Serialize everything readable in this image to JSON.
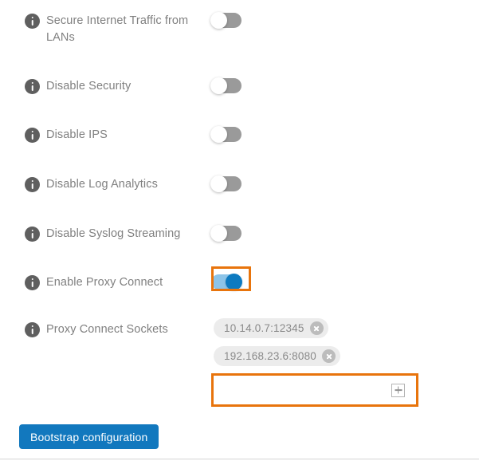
{
  "settings": {
    "rows": [
      {
        "label": "Secure Internet Traffic from LANs",
        "toggle_state": "off",
        "icon": "info-icon",
        "name": "secure-internet-traffic-from-lans"
      },
      {
        "label": "Disable Security",
        "toggle_state": "off",
        "icon": "info-icon",
        "name": "disable-security"
      },
      {
        "label": "Disable IPS",
        "toggle_state": "off",
        "icon": "info-icon",
        "name": "disable-ips"
      },
      {
        "label": "Disable Log Analytics",
        "toggle_state": "off",
        "icon": "info-icon",
        "name": "disable-log-analytics"
      },
      {
        "label": "Disable Syslog Streaming",
        "toggle_state": "off",
        "icon": "info-icon",
        "name": "disable-syslog-streaming"
      },
      {
        "label": "Enable Proxy Connect",
        "toggle_state": "on",
        "icon": "info-icon",
        "name": "enable-proxy-connect",
        "highlighted": true
      }
    ]
  },
  "proxy_sockets": {
    "label": "Proxy Connect Sockets",
    "icon": "info-icon",
    "chips": [
      {
        "value": "10.14.0.7:12345",
        "remove_icon": "close-circle-icon"
      },
      {
        "value": "192.168.23.6:8080",
        "remove_icon": "close-circle-icon"
      }
    ],
    "input_value": "",
    "input_placeholder": "",
    "add_icon": "plus-icon",
    "highlighted": true
  },
  "actions": {
    "bootstrap_label": "Bootstrap configuration"
  },
  "colors": {
    "accent_blue": "#1278be",
    "toggle_on_track": "#8dc4e8",
    "toggle_on_knob": "#0d7ac0",
    "toggle_off_track": "#9a9a9a",
    "highlight_orange": "#e8740c",
    "label_gray": "#808080",
    "chip_bg": "#ececec"
  }
}
